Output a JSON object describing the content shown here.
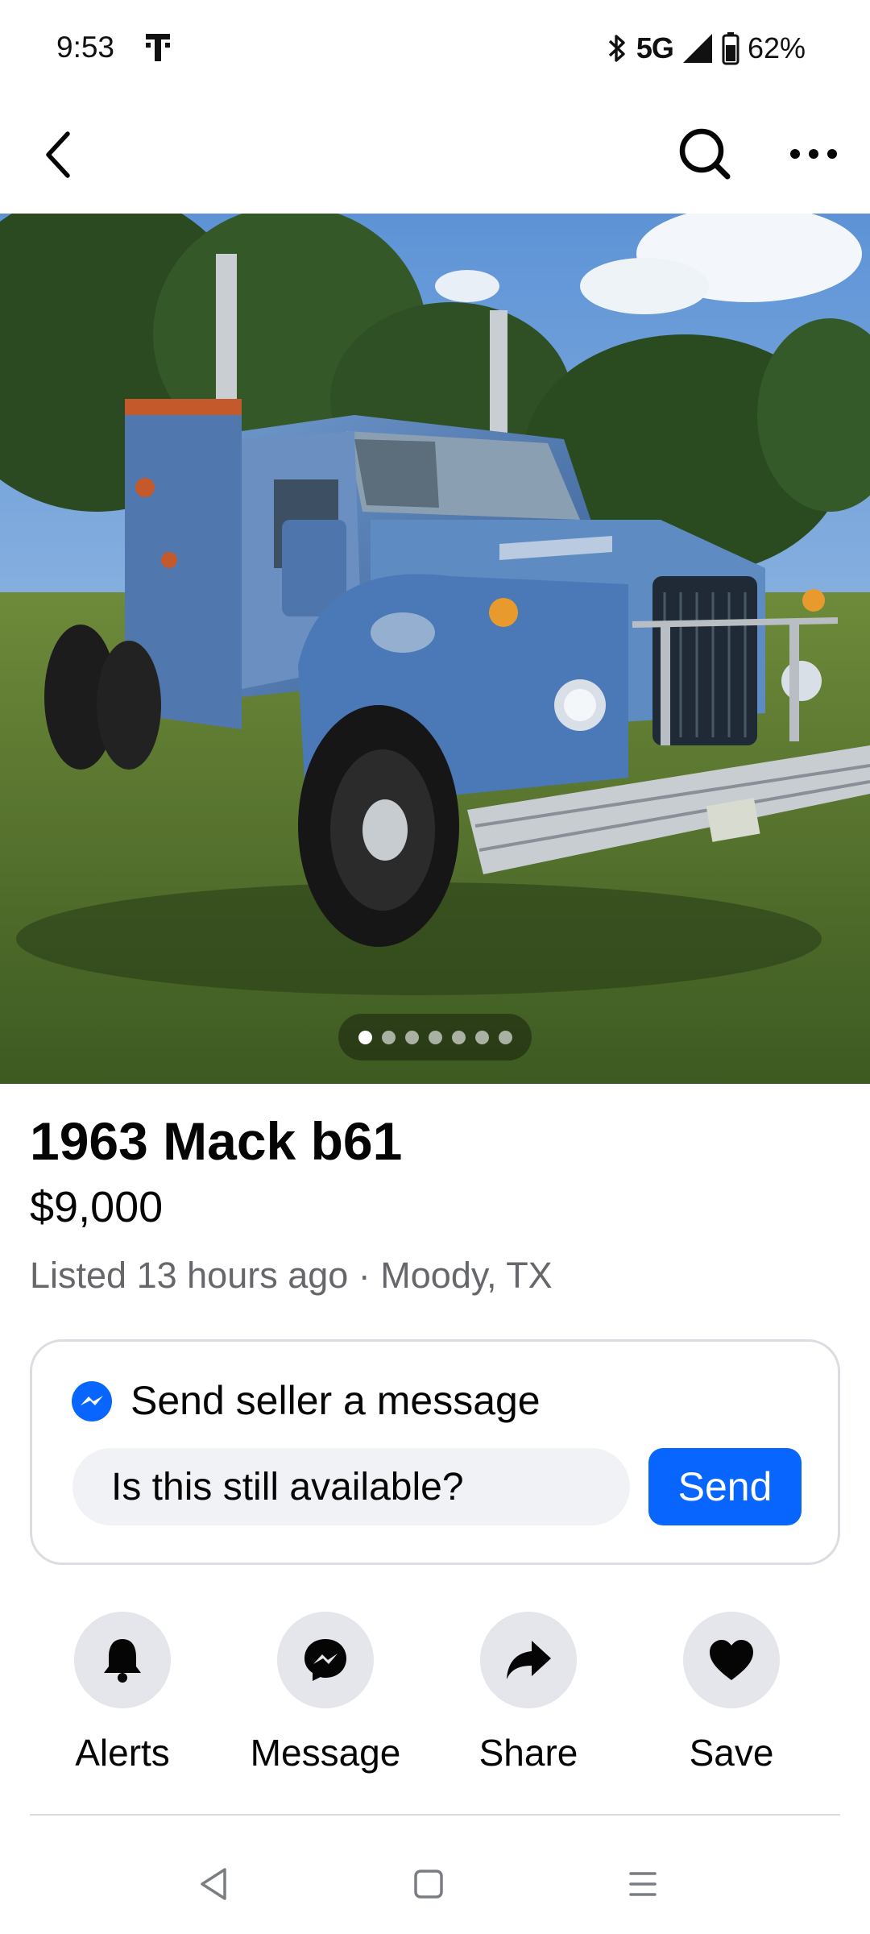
{
  "status_bar": {
    "time": "9:53",
    "network": "5G",
    "battery": "62%",
    "carrier_icon": "t-mobile-icon",
    "bluetooth_icon": "bluetooth-icon"
  },
  "nav": {
    "back_icon": "chevron-left-icon",
    "search_icon": "search-icon",
    "more_icon": "more-horizontal-icon"
  },
  "photo": {
    "dots_total": 7,
    "active_index": 0
  },
  "listing": {
    "title": "1963 Mack b61",
    "price": "$9,000",
    "meta": "Listed 13 hours ago · Moody, TX"
  },
  "message_card": {
    "heading": "Send seller a message",
    "input_value": "Is this still available?",
    "send_label": "Send"
  },
  "actions": [
    {
      "label": "Alerts",
      "icon": "bell-icon"
    },
    {
      "label": "Message",
      "icon": "messenger-icon"
    },
    {
      "label": "Share",
      "icon": "share-arrow-icon"
    },
    {
      "label": "Save",
      "icon": "heart-icon"
    }
  ],
  "colors": {
    "accent": "#0866ff",
    "secondary_text": "#65676b",
    "button_bg": "#e4e6eb",
    "input_bg": "#f0f2f5"
  }
}
